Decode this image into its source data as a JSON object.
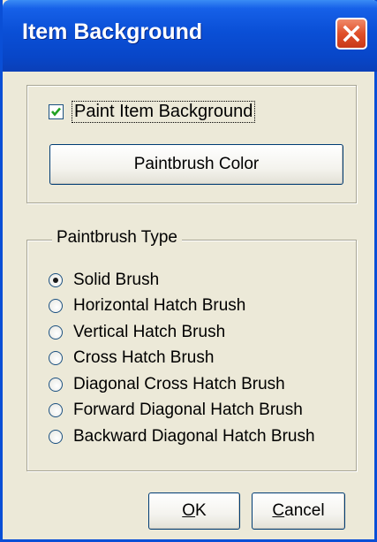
{
  "window": {
    "title": "Item Background"
  },
  "paint_item_background": {
    "label": "Paint Item Background",
    "checked": true
  },
  "paintbrush_color_button": {
    "label": "Paintbrush Color"
  },
  "paintbrush_type": {
    "legend": "Paintbrush Type",
    "selected": "Solid Brush",
    "options": [
      {
        "label": "Solid Brush",
        "selected": true
      },
      {
        "label": "Horizontal Hatch Brush",
        "selected": false
      },
      {
        "label": "Vertical Hatch Brush",
        "selected": false
      },
      {
        "label": "Cross Hatch Brush",
        "selected": false
      },
      {
        "label": "Diagonal Cross Hatch Brush",
        "selected": false
      },
      {
        "label": "Forward Diagonal Hatch Brush",
        "selected": false
      },
      {
        "label": "Backward Diagonal Hatch Brush",
        "selected": false
      }
    ]
  },
  "buttons": {
    "ok": {
      "mnemonic": "O",
      "rest": "K"
    },
    "cancel": {
      "mnemonic": "C",
      "rest": "ancel"
    }
  },
  "icons": {
    "close": "close-icon",
    "checkmark": "checkmark-icon"
  },
  "colors": {
    "title_bar": "#0a4fd6",
    "close_button": "#e0502a",
    "dialog_face": "#ece9d8"
  }
}
